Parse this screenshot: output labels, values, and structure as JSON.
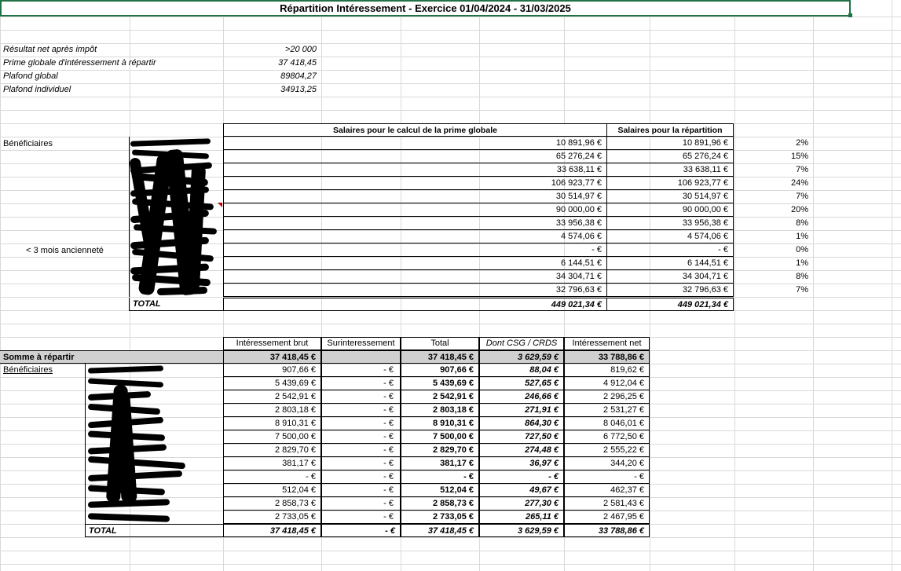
{
  "title": "Répartition Intéressement - Exercice 01/04/2024 - 31/03/2025",
  "params": [
    {
      "label": "Résultat net après impôt",
      "value": ">20 000"
    },
    {
      "label": "Prime globale d'intéressement à répartir",
      "value": "37 418,45"
    },
    {
      "label": "Plafond global",
      "value": "89804,27"
    },
    {
      "label": "Plafond individuel",
      "value": "34913,25"
    }
  ],
  "table1": {
    "header_a": "Salaires pour le calcul de la prime globale",
    "header_b": "Salaires pour la répartition",
    "label_beneficiaires": "Bénéficiaires",
    "label_anciennete": "< 3 mois ancienneté",
    "rows": [
      {
        "a": "10 891,96 €",
        "b": "10 891,96 €",
        "pct": "2%"
      },
      {
        "a": "65 276,24 €",
        "b": "65 276,24 €",
        "pct": "15%"
      },
      {
        "a": "33 638,11 €",
        "b": "33 638,11 €",
        "pct": "7%"
      },
      {
        "a": "106 923,77 €",
        "b": "106 923,77 €",
        "pct": "24%"
      },
      {
        "a": "30 514,97 €",
        "b": "30 514,97 €",
        "pct": "7%"
      },
      {
        "a": "90 000,00 €",
        "b": "90 000,00 €",
        "pct": "20%"
      },
      {
        "a": "33 956,38 €",
        "b": "33 956,38 €",
        "pct": "8%"
      },
      {
        "a": "4 574,06 €",
        "b": "4 574,06 €",
        "pct": "1%"
      },
      {
        "a": "-   €",
        "b": "-   €",
        "pct": "0%"
      },
      {
        "a": "6 144,51 €",
        "b": "6 144,51 €",
        "pct": "1%"
      },
      {
        "a": "34 304,71 €",
        "b": "34 304,71 €",
        "pct": "8%"
      },
      {
        "a": "32 796,63 €",
        "b": "32 796,63 €",
        "pct": "7%"
      }
    ],
    "total_label": "TOTAL",
    "total_a": "449 021,34 €",
    "total_b": "449 021,34 €"
  },
  "table2": {
    "headers": [
      "Intéressement brut",
      "Surinteressement",
      "Total",
      "Dont CSG / CRDS",
      "Intéressement net"
    ],
    "somme_label": "Somme à répartir",
    "somme": [
      "37 418,45 €",
      "",
      "37 418,45 €",
      "3 629,59 €",
      "33 788,86 €"
    ],
    "label_beneficiaires": "Bénéficiaires",
    "rows": [
      [
        "907,66 €",
        "-   €",
        "907,66 €",
        "88,04 €",
        "819,62 €"
      ],
      [
        "5 439,69 €",
        "-   €",
        "5 439,69 €",
        "527,65 €",
        "4 912,04 €"
      ],
      [
        "2 542,91 €",
        "-   €",
        "2 542,91 €",
        "246,66 €",
        "2 296,25 €"
      ],
      [
        "2 803,18 €",
        "-   €",
        "2 803,18 €",
        "271,91 €",
        "2 531,27 €"
      ],
      [
        "8 910,31 €",
        "-   €",
        "8 910,31 €",
        "864,30 €",
        "8 046,01 €"
      ],
      [
        "7 500,00 €",
        "-   €",
        "7 500,00 €",
        "727,50 €",
        "6 772,50 €"
      ],
      [
        "2 829,70 €",
        "-   €",
        "2 829,70 €",
        "274,48 €",
        "2 555,22 €"
      ],
      [
        "381,17 €",
        "-   €",
        "381,17 €",
        "36,97 €",
        "344,20 €"
      ],
      [
        "-   €",
        "-   €",
        "-   €",
        "-   €",
        "-   €"
      ],
      [
        "512,04 €",
        "-   €",
        "512,04 €",
        "49,67 €",
        "462,37 €"
      ],
      [
        "2 858,73 €",
        "-   €",
        "2 858,73 €",
        "277,30 €",
        "2 581,43 €"
      ],
      [
        "2 733,05 €",
        "-   €",
        "2 733,05 €",
        "265,11 €",
        "2 467,95 €"
      ]
    ],
    "total_label": "TOTAL",
    "total": [
      "37 418,45 €",
      "-   €",
      "37 418,45 €",
      "3 629,59 €",
      "33 788,86 €"
    ]
  }
}
